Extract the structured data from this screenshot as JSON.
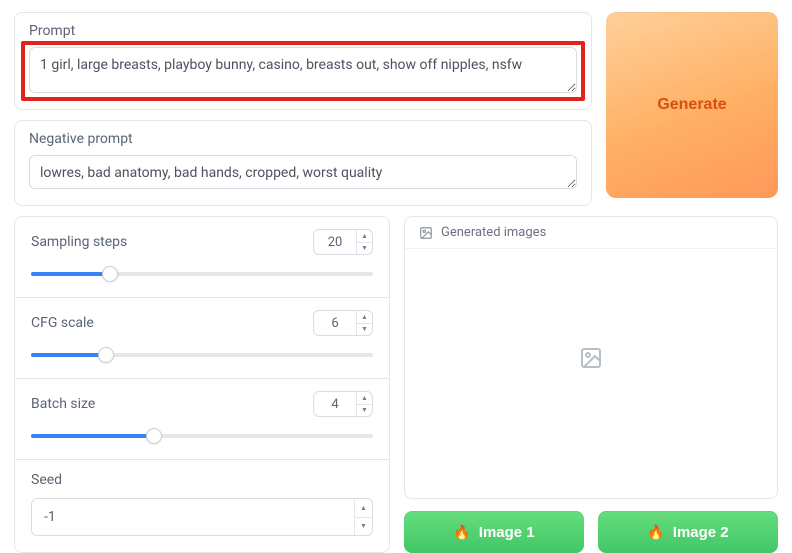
{
  "prompt": {
    "label": "Prompt",
    "value": "1 girl, large breasts, playboy bunny, casino, breasts out, show off nipples, nsfw"
  },
  "negative_prompt": {
    "label": "Negative prompt",
    "value": "lowres, bad anatomy, bad hands, cropped, worst quality"
  },
  "generate_label": "Generate",
  "sliders": {
    "sampling_steps": {
      "label": "Sampling steps",
      "value": 20,
      "fill_pct": 23
    },
    "cfg_scale": {
      "label": "CFG scale",
      "value": 6,
      "fill_pct": 22
    },
    "batch_size": {
      "label": "Batch size",
      "value": 4,
      "fill_pct": 36
    }
  },
  "seed": {
    "label": "Seed",
    "value": "-1"
  },
  "generated_panel": {
    "title": "Generated images"
  },
  "image_buttons": {
    "btn1": "Image 1",
    "btn2": "Image 2"
  }
}
